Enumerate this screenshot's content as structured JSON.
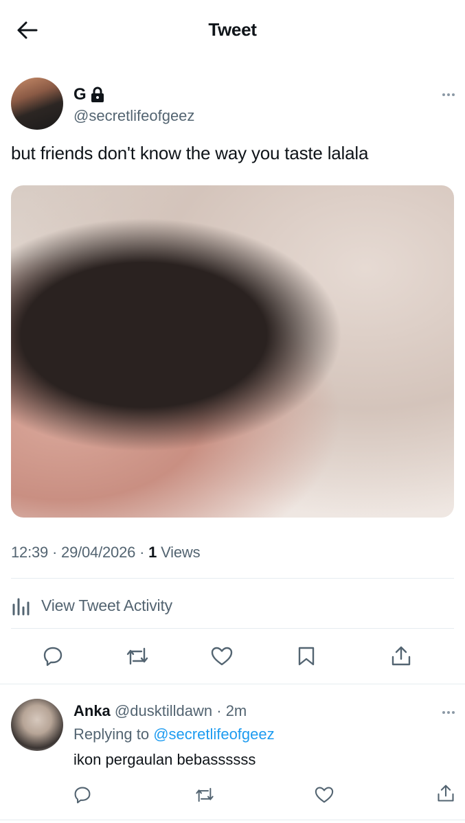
{
  "header": {
    "title": "Tweet"
  },
  "tweet": {
    "author_name": "G",
    "author_handle": "@secretlifeofgeez",
    "text": "but friends don't know the way you taste lalala",
    "time": "12:39",
    "date": "29/04/2026",
    "views_count": "1",
    "views_label": "Views",
    "activity_label": "View Tweet Activity"
  },
  "reply": {
    "author_name": "Anka",
    "author_handle": "@dusktilldawn",
    "time": "2m",
    "replying_prefix": "Replying to",
    "replying_to": "@secretlifeofgeez",
    "text": "ikon pergaulan bebassssss"
  },
  "colors": {
    "text_primary": "#0f1419",
    "text_secondary": "#536471",
    "link": "#1d9bf0",
    "divider": "#e6ecf0"
  }
}
